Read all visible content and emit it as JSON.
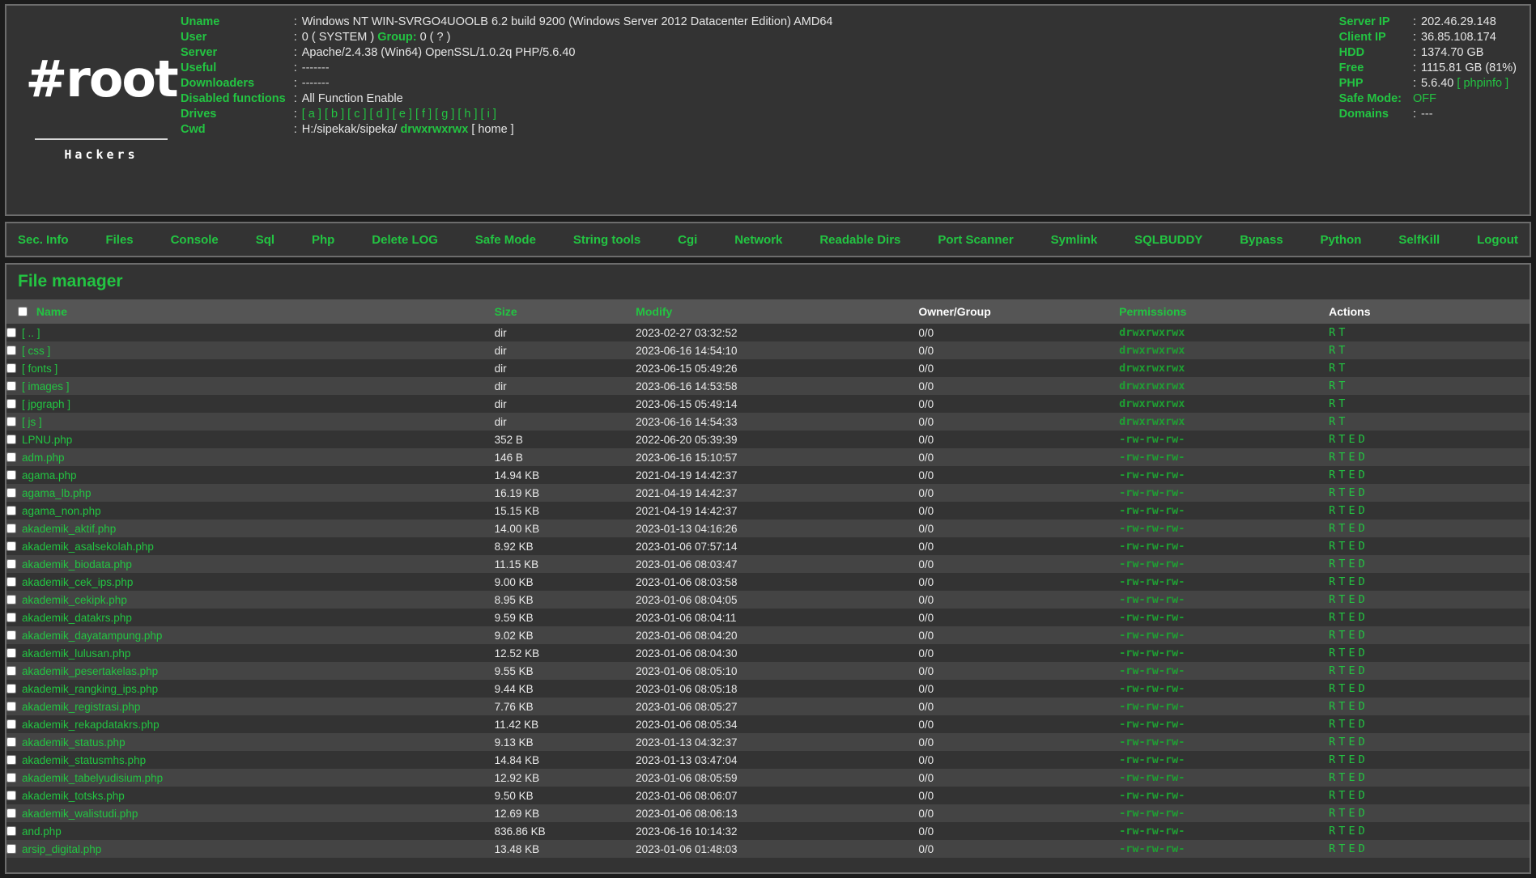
{
  "logo": {
    "mark": "#root",
    "tagline": "Hackers"
  },
  "info": {
    "rows": [
      {
        "key": "Uname",
        "value": "Windows NT WIN-SVRGO4UOOLB 6.2 build 9200 (Windows Server 2012 Datacenter Edition) AMD64"
      },
      {
        "key": "User",
        "value": "0 ( SYSTEM )",
        "extra_key": "Group:",
        "extra_value": "0 ( ? )"
      },
      {
        "key": "Server",
        "value": "Apache/2.4.38 (Win64) OpenSSL/1.0.2q PHP/5.6.40"
      },
      {
        "key": "Useful",
        "value": "-------"
      },
      {
        "key": "Downloaders",
        "value": "-------"
      },
      {
        "key": "Disabled functions",
        "value": "All Function Enable"
      },
      {
        "key": "Drives",
        "value": "[ a ] [ b ] [ c ] [ d ] [ e ] [ f ] [ g ] [ h ] [ i ]"
      },
      {
        "key": "Cwd",
        "value": "H:/sipekak/sipeka/",
        "perm": "drwxrwxrwx",
        "home": "[ home ]"
      }
    ]
  },
  "system": {
    "server_ip_label": "Server IP",
    "server_ip": "202.46.29.148",
    "client_ip_label": "Client IP",
    "client_ip": "36.85.108.174",
    "hdd_label": "HDD",
    "hdd": "1374.70 GB",
    "free_label": "Free",
    "free": "1115.81 GB (81%)",
    "php_label": "PHP",
    "php": "5.6.40",
    "phpinfo": "[ phpinfo ]",
    "safe_mode_label": "Safe Mode:",
    "safe_mode": "OFF",
    "domains_label": "Domains",
    "domains": "---"
  },
  "nav": {
    "items": [
      "Sec. Info",
      "Files",
      "Console",
      "Sql",
      "Php",
      "Delete LOG",
      "Safe Mode",
      "String tools",
      "Cgi",
      "Network",
      "Readable Dirs",
      "Port Scanner",
      "Symlink",
      "SQLBUDDY",
      "Bypass",
      "Python",
      "SelfKill",
      "Logout"
    ]
  },
  "filemanager": {
    "title": "File manager",
    "columns": {
      "name": "Name",
      "size": "Size",
      "modify": "Modify",
      "owner": "Owner/Group",
      "permissions": "Permissions",
      "actions": "Actions"
    },
    "actions": {
      "read": "R",
      "touch": "T",
      "edit": "E",
      "delete": "D"
    },
    "rows": [
      {
        "name": "[ .. ]",
        "size": "dir",
        "modify": "2023-02-27 03:32:52",
        "owner": "0/0",
        "perm": "drwxrwxrwx",
        "actions": "R T",
        "type": "dir"
      },
      {
        "name": "[ css ]",
        "size": "dir",
        "modify": "2023-06-16 14:54:10",
        "owner": "0/0",
        "perm": "drwxrwxrwx",
        "actions": "R T",
        "type": "dir"
      },
      {
        "name": "[ fonts ]",
        "size": "dir",
        "modify": "2023-06-15 05:49:26",
        "owner": "0/0",
        "perm": "drwxrwxrwx",
        "actions": "R T",
        "type": "dir"
      },
      {
        "name": "[ images ]",
        "size": "dir",
        "modify": "2023-06-16 14:53:58",
        "owner": "0/0",
        "perm": "drwxrwxrwx",
        "actions": "R T",
        "type": "dir"
      },
      {
        "name": "[ jpgraph ]",
        "size": "dir",
        "modify": "2023-06-15 05:49:14",
        "owner": "0/0",
        "perm": "drwxrwxrwx",
        "actions": "R T",
        "type": "dir"
      },
      {
        "name": "[ js ]",
        "size": "dir",
        "modify": "2023-06-16 14:54:33",
        "owner": "0/0",
        "perm": "drwxrwxrwx",
        "actions": "R T",
        "type": "dir"
      },
      {
        "name": "LPNU.php",
        "size": "352 B",
        "modify": "2022-06-20 05:39:39",
        "owner": "0/0",
        "perm": "-rw-rw-rw-",
        "actions": "R T E D",
        "type": "file"
      },
      {
        "name": "adm.php",
        "size": "146 B",
        "modify": "2023-06-16 15:10:57",
        "owner": "0/0",
        "perm": "-rw-rw-rw-",
        "actions": "R T E D",
        "type": "file"
      },
      {
        "name": "agama.php",
        "size": "14.94 KB",
        "modify": "2021-04-19 14:42:37",
        "owner": "0/0",
        "perm": "-rw-rw-rw-",
        "actions": "R T E D",
        "type": "file"
      },
      {
        "name": "agama_lb.php",
        "size": "16.19 KB",
        "modify": "2021-04-19 14:42:37",
        "owner": "0/0",
        "perm": "-rw-rw-rw-",
        "actions": "R T E D",
        "type": "file"
      },
      {
        "name": "agama_non.php",
        "size": "15.15 KB",
        "modify": "2021-04-19 14:42:37",
        "owner": "0/0",
        "perm": "-rw-rw-rw-",
        "actions": "R T E D",
        "type": "file"
      },
      {
        "name": "akademik_aktif.php",
        "size": "14.00 KB",
        "modify": "2023-01-13 04:16:26",
        "owner": "0/0",
        "perm": "-rw-rw-rw-",
        "actions": "R T E D",
        "type": "file"
      },
      {
        "name": "akademik_asalsekolah.php",
        "size": "8.92 KB",
        "modify": "2023-01-06 07:57:14",
        "owner": "0/0",
        "perm": "-rw-rw-rw-",
        "actions": "R T E D",
        "type": "file"
      },
      {
        "name": "akademik_biodata.php",
        "size": "11.15 KB",
        "modify": "2023-01-06 08:03:47",
        "owner": "0/0",
        "perm": "-rw-rw-rw-",
        "actions": "R T E D",
        "type": "file"
      },
      {
        "name": "akademik_cek_ips.php",
        "size": "9.00 KB",
        "modify": "2023-01-06 08:03:58",
        "owner": "0/0",
        "perm": "-rw-rw-rw-",
        "actions": "R T E D",
        "type": "file"
      },
      {
        "name": "akademik_cekipk.php",
        "size": "8.95 KB",
        "modify": "2023-01-06 08:04:05",
        "owner": "0/0",
        "perm": "-rw-rw-rw-",
        "actions": "R T E D",
        "type": "file"
      },
      {
        "name": "akademik_datakrs.php",
        "size": "9.59 KB",
        "modify": "2023-01-06 08:04:11",
        "owner": "0/0",
        "perm": "-rw-rw-rw-",
        "actions": "R T E D",
        "type": "file"
      },
      {
        "name": "akademik_dayatampung.php",
        "size": "9.02 KB",
        "modify": "2023-01-06 08:04:20",
        "owner": "0/0",
        "perm": "-rw-rw-rw-",
        "actions": "R T E D",
        "type": "file"
      },
      {
        "name": "akademik_lulusan.php",
        "size": "12.52 KB",
        "modify": "2023-01-06 08:04:30",
        "owner": "0/0",
        "perm": "-rw-rw-rw-",
        "actions": "R T E D",
        "type": "file"
      },
      {
        "name": "akademik_pesertakelas.php",
        "size": "9.55 KB",
        "modify": "2023-01-06 08:05:10",
        "owner": "0/0",
        "perm": "-rw-rw-rw-",
        "actions": "R T E D",
        "type": "file"
      },
      {
        "name": "akademik_rangking_ips.php",
        "size": "9.44 KB",
        "modify": "2023-01-06 08:05:18",
        "owner": "0/0",
        "perm": "-rw-rw-rw-",
        "actions": "R T E D",
        "type": "file"
      },
      {
        "name": "akademik_registrasi.php",
        "size": "7.76 KB",
        "modify": "2023-01-06 08:05:27",
        "owner": "0/0",
        "perm": "-rw-rw-rw-",
        "actions": "R T E D",
        "type": "file"
      },
      {
        "name": "akademik_rekapdatakrs.php",
        "size": "11.42 KB",
        "modify": "2023-01-06 08:05:34",
        "owner": "0/0",
        "perm": "-rw-rw-rw-",
        "actions": "R T E D",
        "type": "file"
      },
      {
        "name": "akademik_status.php",
        "size": "9.13 KB",
        "modify": "2023-01-13 04:32:37",
        "owner": "0/0",
        "perm": "-rw-rw-rw-",
        "actions": "R T E D",
        "type": "file"
      },
      {
        "name": "akademik_statusmhs.php",
        "size": "14.84 KB",
        "modify": "2023-01-13 03:47:04",
        "owner": "0/0",
        "perm": "-rw-rw-rw-",
        "actions": "R T E D",
        "type": "file"
      },
      {
        "name": "akademik_tabelyudisium.php",
        "size": "12.92 KB",
        "modify": "2023-01-06 08:05:59",
        "owner": "0/0",
        "perm": "-rw-rw-rw-",
        "actions": "R T E D",
        "type": "file"
      },
      {
        "name": "akademik_totsks.php",
        "size": "9.50 KB",
        "modify": "2023-01-06 08:06:07",
        "owner": "0/0",
        "perm": "-rw-rw-rw-",
        "actions": "R T E D",
        "type": "file"
      },
      {
        "name": "akademik_walistudi.php",
        "size": "12.69 KB",
        "modify": "2023-01-06 08:06:13",
        "owner": "0/0",
        "perm": "-rw-rw-rw-",
        "actions": "R T E D",
        "type": "file"
      },
      {
        "name": "and.php",
        "size": "836.86 KB",
        "modify": "2023-06-16 10:14:32",
        "owner": "0/0",
        "perm": "-rw-rw-rw-",
        "actions": "R T E D",
        "type": "file"
      },
      {
        "name": "arsip_digital.php",
        "size": "13.48 KB",
        "modify": "2023-01-06 01:48:03",
        "owner": "0/0",
        "perm": "-rw-rw-rw-",
        "actions": "R T E D",
        "type": "file"
      }
    ]
  },
  "colors": {
    "accent_green": "#23c442",
    "perm_green": "#1f9f33",
    "panel_bg": "#333333",
    "panel_border": "#6d6d6d",
    "row_alt_bg": "#444444",
    "header_row_bg": "#555555",
    "page_bg": "#1c1c1c",
    "text_white": "#e8e8e8"
  }
}
